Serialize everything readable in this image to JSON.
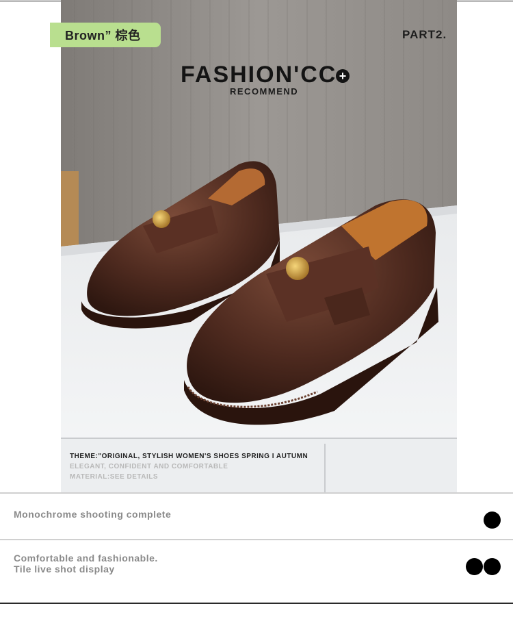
{
  "tag": {
    "label": "Brown” 棕色",
    "color": "#b9df8f"
  },
  "part_label": "PART2.",
  "brand": {
    "title": "FASHION'CC",
    "plus_symbol": "+",
    "subtitle": "RECOMMEND"
  },
  "photo": {
    "theme_line": "THEME:\"ORIGINAL, STYLISH WOMEN'S SHOES SPRING I AUTUMN",
    "elegant_line": "ELEGANT, CONFIDENT AND COMFORTABLE",
    "material_line": "MATERIAL:SEE DETAILS"
  },
  "sections": [
    {
      "line1": "Monochrome shooting complete",
      "line2": "",
      "dots": 1
    },
    {
      "line1": "Comfortable and fashionable.",
      "line2": "Tile live shot display",
      "dots": 2
    }
  ]
}
